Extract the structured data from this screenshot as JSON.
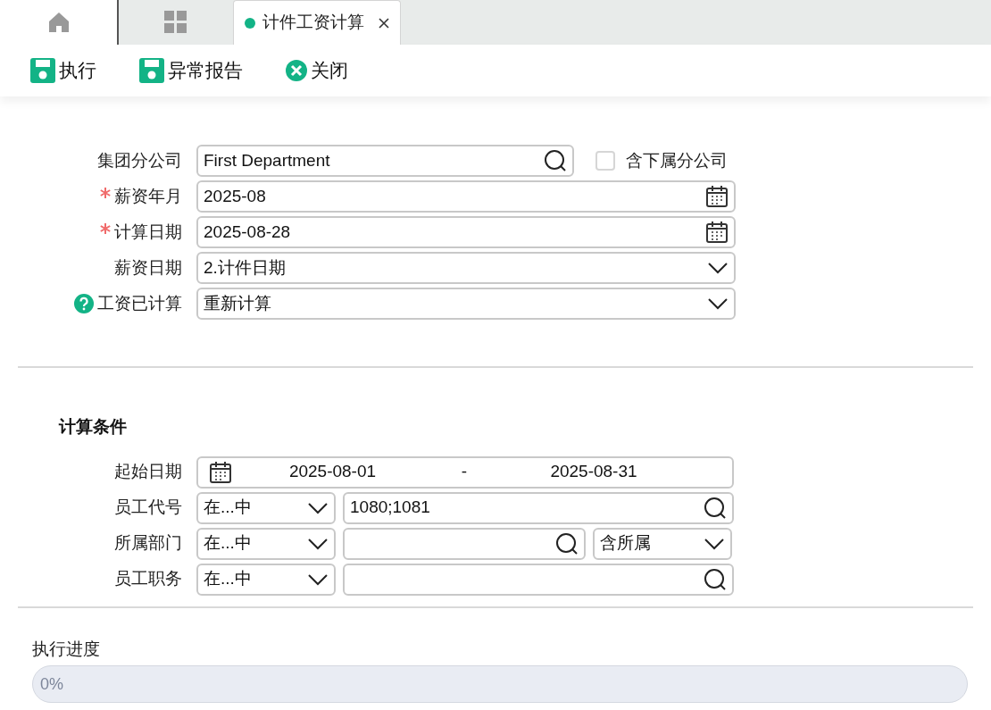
{
  "tabs": [
    {
      "kind": "home",
      "selected": false
    },
    {
      "kind": "apps",
      "selected": false
    },
    {
      "kind": "page",
      "label": "计件工资计算",
      "selected": true
    }
  ],
  "toolbar": [
    {
      "label": "执行",
      "kind": "save"
    },
    {
      "label": "异常报告",
      "kind": "save"
    },
    {
      "label": "关闭",
      "kind": "close"
    }
  ],
  "main_form": [
    {
      "label": "集团分公司",
      "required": false,
      "help": false,
      "kind": "lookup",
      "value": "First Department",
      "checkbox": {
        "label": "含下属分公司",
        "checked": false
      }
    },
    {
      "label": "薪资年月",
      "required": true,
      "help": false,
      "kind": "date",
      "value": "2025-08"
    },
    {
      "label": "计算日期",
      "required": true,
      "help": false,
      "kind": "date",
      "value": "2025-08-28"
    },
    {
      "label": "薪资日期",
      "required": false,
      "help": false,
      "kind": "select",
      "value": "2.计件日期"
    },
    {
      "label": "工资已计算",
      "required": false,
      "help": true,
      "kind": "select",
      "value": "重新计算"
    }
  ],
  "conditions": {
    "title": "计算条件",
    "rows": [
      {
        "kind": "range",
        "label": "起始日期",
        "from": "2025-08-01",
        "separator": "-",
        "to": "2025-08-31"
      },
      {
        "kind": "filter",
        "label": "员工代号",
        "operator": "在...中",
        "value": "1080;1081"
      },
      {
        "kind": "filter",
        "label": "所属部门",
        "operator": "在...中",
        "value": "",
        "scope": "含所属"
      },
      {
        "kind": "filter",
        "label": "员工职务",
        "operator": "在...中",
        "value": ""
      }
    ]
  },
  "progress": {
    "label": "执行进度",
    "level": 0,
    "reading": "0%"
  }
}
